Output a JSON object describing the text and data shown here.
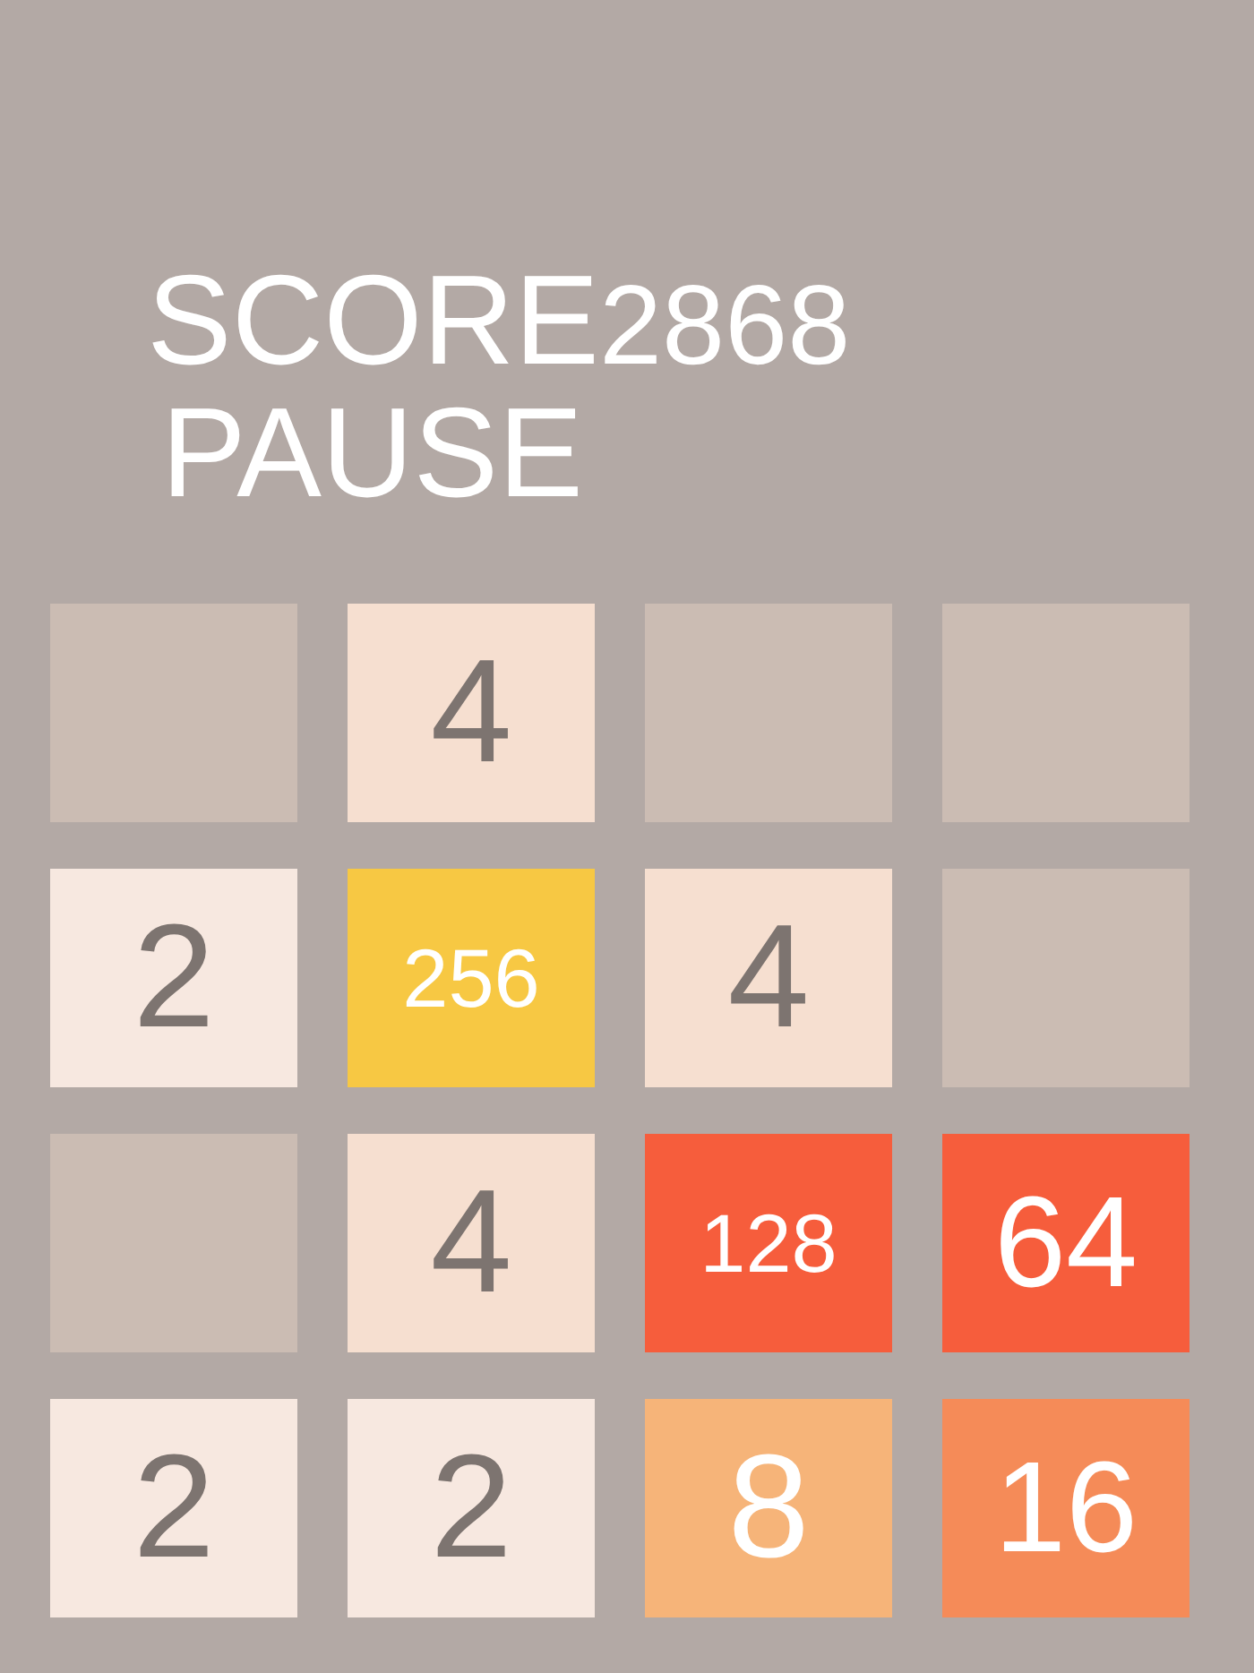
{
  "score": {
    "label": "SCORE",
    "value": "2868"
  },
  "pause_button": {
    "label": "PAUSE"
  },
  "board": {
    "tiles": [
      {
        "kind": "empty",
        "color": "#cbbcb3"
      },
      {
        "kind": "number",
        "value": "4",
        "color": "#f6dfd0"
      },
      {
        "kind": "empty",
        "color": "#cbbcb3"
      },
      {
        "kind": "empty",
        "color": "#cbbcb3"
      },
      {
        "kind": "number",
        "value": "2",
        "color": "#f7e8e0"
      },
      {
        "kind": "number",
        "value": "256",
        "color": "#f7c843"
      },
      {
        "kind": "number",
        "value": "4",
        "color": "#f6dfd0"
      },
      {
        "kind": "empty",
        "color": "#cbbcb3"
      },
      {
        "kind": "empty",
        "color": "#cbbcb3"
      },
      {
        "kind": "number",
        "value": "4",
        "color": "#f6dfd0"
      },
      {
        "kind": "number",
        "value": "128",
        "color": "#f65d3c"
      },
      {
        "kind": "number",
        "value": "64",
        "color": "#f65d3c"
      },
      {
        "kind": "number",
        "value": "2",
        "color": "#f7e8e0"
      },
      {
        "kind": "number",
        "value": "2",
        "color": "#f7e8e0"
      },
      {
        "kind": "number",
        "value": "8",
        "color": "#f6b479"
      },
      {
        "kind": "number",
        "value": "16",
        "color": "#f58b58"
      }
    ]
  }
}
